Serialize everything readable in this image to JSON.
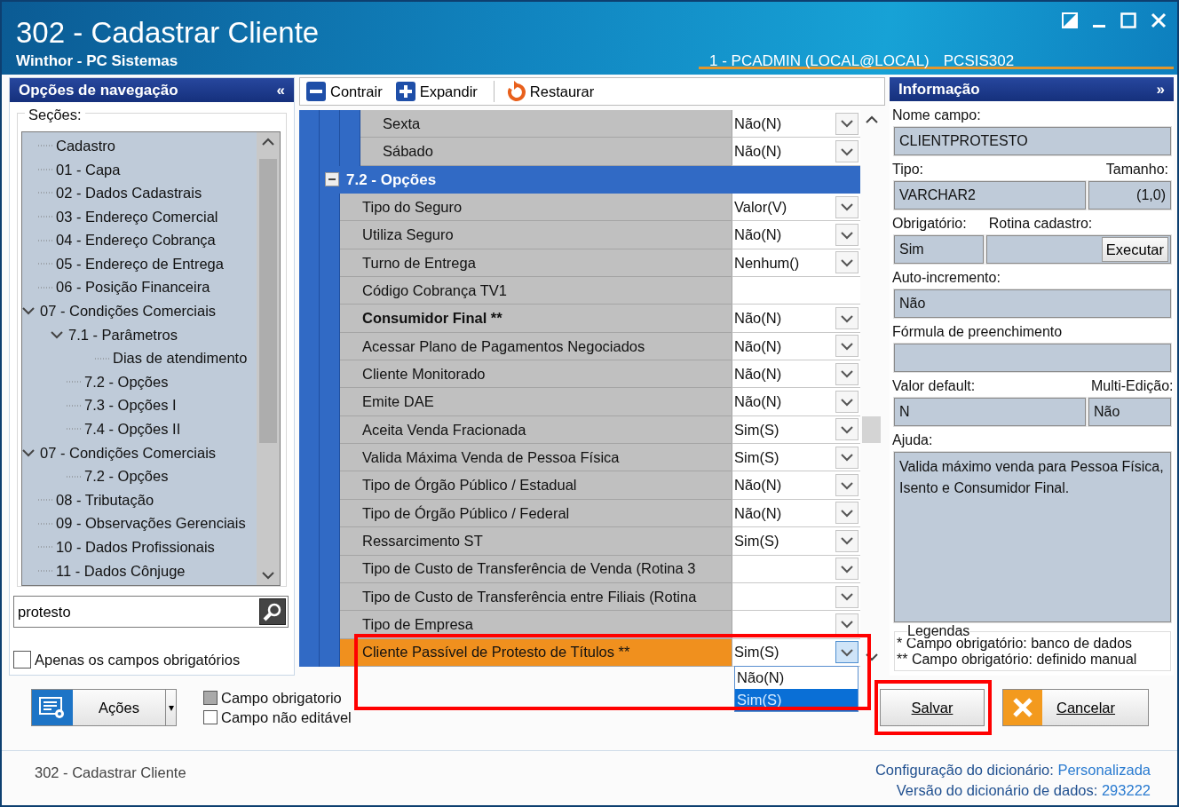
{
  "window": {
    "title": "302 - Cadastrar Cliente",
    "subtitle": "Winthor - PC Sistemas",
    "user": "1 - PCADMIN (LOCAL@LOCAL)",
    "routine": "PCSIS302"
  },
  "navigation": {
    "title": "Opções de navegação",
    "collapse_glyph": "«",
    "sections_label": "Seções:",
    "tree": [
      {
        "label": "Cadastro"
      },
      {
        "label": "01 - Capa"
      },
      {
        "label": "02 - Dados Cadastrais"
      },
      {
        "label": "03 - Endereço Comercial"
      },
      {
        "label": "04 - Endereço Cobrança"
      },
      {
        "label": "05 - Endereço de Entrega"
      },
      {
        "label": "06 - Posição Financeira"
      },
      {
        "label": "07 - Condições Comerciais",
        "expanded": true,
        "children": [
          {
            "label": "7.1 - Parâmetros",
            "expanded": true,
            "children": [
              {
                "label": "Dias de atendimento"
              }
            ]
          },
          {
            "label": "7.2 - Opções"
          },
          {
            "label": "7.3 - Opções I"
          },
          {
            "label": "7.4 - Opções II"
          }
        ]
      },
      {
        "label": "07 - Condições Comerciais",
        "expanded": true,
        "children": [
          {
            "label": "7.2 - Opções"
          }
        ]
      },
      {
        "label": "08 - Tributação"
      },
      {
        "label": "09 - Observações Gerenciais"
      },
      {
        "label": "10 - Dados Profissionais"
      },
      {
        "label": "11 - Dados Cônjuge"
      }
    ],
    "search": {
      "value": "protesto"
    },
    "only_required": {
      "label": "Apenas os campos obrigatórios",
      "checked": false
    }
  },
  "toolbar": [
    {
      "kind": "collapse",
      "label": "Contrair"
    },
    {
      "kind": "expand",
      "label": "Expandir"
    },
    {
      "kind": "restore",
      "label": "Restaurar"
    }
  ],
  "grid": {
    "rows": [
      {
        "kind": "sub-property",
        "label": "Sexta",
        "value": "Não(N)",
        "dropdown": true,
        "selected": false
      },
      {
        "kind": "sub-property",
        "label": "Sábado",
        "value": "Não(N)",
        "dropdown": true,
        "selected": false
      },
      {
        "kind": "group",
        "label": "7.2 - Opções",
        "expanded": true
      },
      {
        "kind": "property",
        "label": "Tipo do Seguro",
        "value": "Valor(V)",
        "dropdown": true,
        "selected": false
      },
      {
        "kind": "property",
        "label": "Utiliza Seguro",
        "value": "Não(N)",
        "dropdown": true,
        "selected": false
      },
      {
        "kind": "property",
        "label": "Turno de Entrega",
        "value": "Nenhum()",
        "dropdown": true,
        "selected": false
      },
      {
        "kind": "property",
        "label": "Código Cobrança TV1",
        "dropdown": false,
        "selected": false
      },
      {
        "kind": "property",
        "label": "Consumidor Final **",
        "value": "Não(N)",
        "dropdown": true,
        "bold": true,
        "selected": false
      },
      {
        "kind": "property",
        "label": "Acessar Plano de Pagamentos Negociados",
        "value": "Não(N)",
        "dropdown": true,
        "selected": false
      },
      {
        "kind": "property",
        "label": "Cliente Monitorado",
        "value": "Não(N)",
        "dropdown": true,
        "selected": false
      },
      {
        "kind": "property",
        "label": "Emite DAE",
        "value": "Não(N)",
        "dropdown": true,
        "selected": false
      },
      {
        "kind": "property",
        "label": "Aceita Venda Fracionada",
        "value": "Sim(S)",
        "dropdown": true,
        "selected": false
      },
      {
        "kind": "property",
        "label": "Valida Máxima Venda de Pessoa Física",
        "value": "Sim(S)",
        "dropdown": true,
        "selected": false
      },
      {
        "kind": "property",
        "label": "Tipo de Órgão Público / Estadual",
        "value": "Não(N)",
        "dropdown": true,
        "selected": false
      },
      {
        "kind": "property",
        "label": "Tipo de Órgão Público / Federal",
        "value": "Não(N)",
        "dropdown": true,
        "selected": false
      },
      {
        "kind": "property",
        "label": "Ressarcimento ST",
        "value": "Sim(S)",
        "dropdown": true,
        "selected": false
      },
      {
        "kind": "property",
        "label": "Tipo de Custo de Transferência de Venda (Rotina 3",
        "dropdown": true,
        "selected": false
      },
      {
        "kind": "property",
        "label": "Tipo de Custo de Transferência entre Filiais (Rotina",
        "dropdown": true,
        "selected": false
      },
      {
        "kind": "property",
        "label": "Tipo de Empresa",
        "dropdown": true,
        "selected": false
      },
      {
        "kind": "property",
        "label": "Cliente Passível de Protesto de Títulos **",
        "value": "Sim(S)",
        "dropdown": true,
        "selected": true,
        "highlighted": true,
        "open": true,
        "options": [
          {
            "label": "Não(N)",
            "selected": false
          },
          {
            "label": "Sim(S)",
            "selected": true
          }
        ]
      }
    ]
  },
  "info": {
    "title": "Informação",
    "collapse_glyph": "»",
    "rows": [
      {
        "fields": [
          {
            "label": "Nome campo:",
            "value": "CLIENTPROTESTO"
          }
        ]
      },
      {
        "fields": [
          {
            "label": "Tipo:",
            "value": "VARCHAR2",
            "kind": "wide"
          },
          {
            "label": "Tamanho:",
            "value": "(1,0)",
            "kind": "narrow",
            "right_aligned": true
          }
        ]
      },
      {
        "fields": [
          {
            "label": "Obrigatório:",
            "value": "Sim",
            "kind": "narrow"
          },
          {
            "label": "Rotina cadastro:",
            "button": "Executar",
            "kind": "wide"
          }
        ]
      },
      {
        "fields": [
          {
            "label": "Auto-incremento:",
            "value": "Não"
          }
        ]
      },
      {
        "fields": [
          {
            "label": "Fórmula de preenchimento"
          }
        ]
      },
      {
        "fields": [
          {
            "label": "Valor default:",
            "value": "N",
            "kind": "wide"
          },
          {
            "label": "Multi-Edição:",
            "value": "Não",
            "kind": "narrow"
          }
        ]
      },
      {
        "fields": [
          {
            "label": "Ajuda:",
            "value": "Valida máximo venda para Pessoa Física, Isento e Consumidor Final.",
            "kind": "memo"
          }
        ]
      }
    ],
    "legend": {
      "title": "Legendas",
      "lines": [
        "* Campo obrigatório: banco de dados",
        "** Campo obrigatório: definido manual"
      ]
    }
  },
  "actions": {
    "label": "Ações",
    "caret": "▾"
  },
  "field_legend": [
    {
      "label": "Campo obrigatorio",
      "color": "#a9a9a9"
    },
    {
      "label": "Campo não editável",
      "color": "#ffffff"
    }
  ],
  "buttons": [
    {
      "kind": "save",
      "label": "Salvar",
      "highlighted": true
    },
    {
      "kind": "cancel",
      "label": "Cancelar",
      "highlighted": false
    }
  ],
  "status_bar": {
    "left": "302 - Cadastrar Cliente",
    "lines": [
      {
        "label": "Configuração do dicionário:",
        "value": "Personalizada"
      },
      {
        "label": "Versão do dicionário de dados:",
        "value": "293222"
      }
    ]
  }
}
